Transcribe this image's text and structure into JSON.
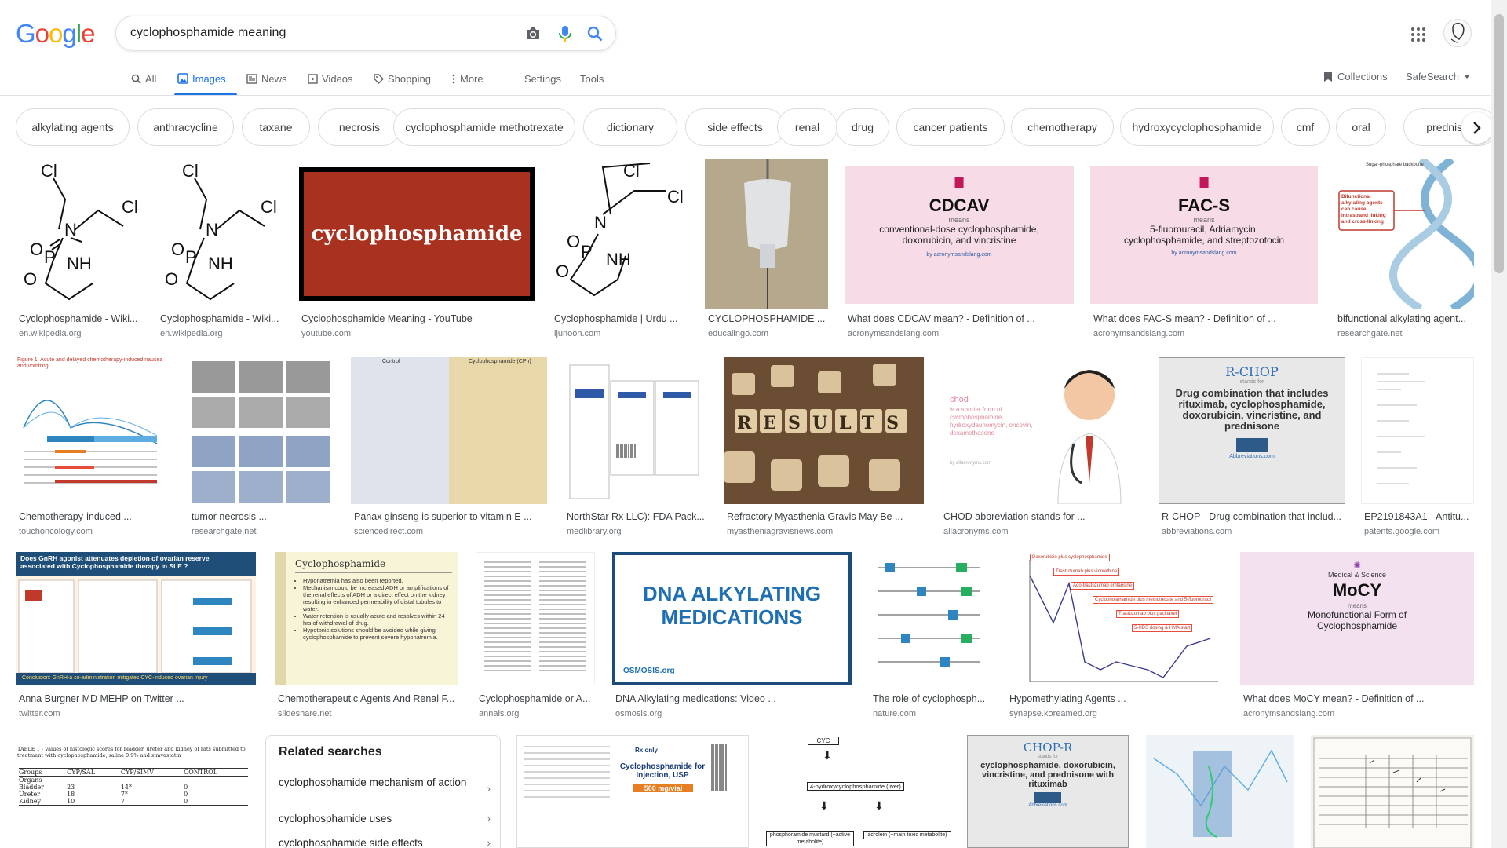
{
  "header": {
    "logo": [
      "G",
      "o",
      "o",
      "g",
      "l",
      "e"
    ],
    "search_value": "cyclophosphamide meaning",
    "icons": [
      "camera-icon",
      "microphone-icon",
      "search-icon",
      "apps-grid-icon"
    ]
  },
  "tabs": [
    {
      "label": "All",
      "icon": "search-icon"
    },
    {
      "label": "Images",
      "icon": "image-icon"
    },
    {
      "label": "News",
      "icon": "newspaper-icon"
    },
    {
      "label": "Videos",
      "icon": "video-icon"
    },
    {
      "label": "Shopping",
      "icon": "tag-icon"
    },
    {
      "label": "More",
      "icon": "more-vert-icon"
    }
  ],
  "tools": {
    "settings": "Settings",
    "tools": "Tools",
    "collections": "Collections",
    "safesearch": "SafeSearch"
  },
  "chips": [
    "alkylating agents",
    "anthracycline",
    "taxane",
    "necrosis",
    "cyclophosphamide methotrexate",
    "dictionary",
    "side effects",
    "renal",
    "drug",
    "cancer patients",
    "chemotherapy",
    "hydroxycyclophosphamide",
    "cmf",
    "oral",
    "prednison"
  ],
  "results": [
    {
      "title": "Cyclophosphamide - Wiki...",
      "source": "en.wikipedia.org"
    },
    {
      "title": "Cyclophosphamide - Wiki...",
      "source": "en.wikipedia.org"
    },
    {
      "title": "Cyclophosphamide Meaning - YouTube",
      "source": "youtube.com",
      "image_text": "cyclophosphamide"
    },
    {
      "title": "Cyclophosphamide | Urdu ...",
      "source": "ijunoon.com"
    },
    {
      "title": "CYCLOPHOSPHAMIDE ...",
      "source": "educalingo.com"
    },
    {
      "title": "What does CDCAV mean? - Definition of ...",
      "source": "acronymsandslang.com",
      "image_head": "CDCAV",
      "image_means": "means",
      "image_body": "conventional-dose cyclophosphamide, doxorubicin, and vincristine",
      "image_foot": "by acronymsandslang.com"
    },
    {
      "title": "What does FAC-S mean? - Definition of ...",
      "source": "acronymsandslang.com",
      "image_head": "FAC-S",
      "image_means": "means",
      "image_body": "5-fluorouracil, Adriamycin, cyclophosphamide, and streptozotocin",
      "image_foot": "by acronymsandslang.com"
    },
    {
      "title": "bifunctional alkylating agent...",
      "source": "researchgate.net",
      "image_head": "Sugar-phosphate backbone",
      "image_body": "Bifunctional alkylating agents can cause intrastrand linking and cross-linking"
    },
    {
      "title": "Chemotherapy-induced ...",
      "source": "touchoncology.com",
      "image_head": "Figure 1: Acute and delayed chemotherapy-induced nausea and vomiting"
    },
    {
      "title": "tumor necrosis ...",
      "source": "researchgate.net"
    },
    {
      "title": "Panax ginseng is superior to vitamin E ...",
      "source": "sciencedirect.com",
      "image_left": "Control",
      "image_right": "Cyclophosphamide (CPh)"
    },
    {
      "title": "NorthStar Rx LLC): FDA Pack...",
      "source": "medlibrary.org"
    },
    {
      "title": "Refractory Myasthenia Gravis May Be ...",
      "source": "myastheniagravisnews.com",
      "image_head": "RESULTS"
    },
    {
      "title": "CHOD abbreviation stands for ...",
      "source": "allacronyms.com",
      "image_head": "chod",
      "image_body": "is a shorter form of cyclophosphamide, hydroxydaunomycin, oncovin, dexamethasone",
      "image_foot": "by allacronyms.com"
    },
    {
      "title": "R-CHOP - Drug combination that includ...",
      "source": "abbreviations.com",
      "image_head": "R-CHOP",
      "image_means": "stands for",
      "image_body": "Drug combination that includes rituximab, cyclophosphamide, doxorubicin, vincristine, and prednisone",
      "image_foot": "Abbreviations.com"
    },
    {
      "title": "EP2191843A1 - Antitu...",
      "source": "patents.google.com"
    },
    {
      "title": "Anna Burgner MD MEHP on Twitter ...",
      "source": "twitter.com",
      "image_head": "Does GnRH agonist attenuates depletion of ovarian reserve associated with Cyclophosphamide therapy in SLE ?",
      "image_foot": "Conclusion: GnRH-a co-administration mitigates CYC-induced ovarian injury"
    },
    {
      "title": "Chemotherapeutic Agents And Renal F...",
      "source": "slideshare.net",
      "image_head": "Cyclophosphamide",
      "image_body": [
        "Hyponatremia has also been reported.",
        "Mechanism could be increased ADH or amplifications of the renal effects of ADH or a direct effect on the kidney resulting in enhanced permeability of distal tubules to water.",
        "Water retention is usually acute and resolves within 24 hrs of withdrawal of drug.",
        "Hypotonic solutions should be avoided while giving cyclophosphamide to prevent severe hyponatremia."
      ]
    },
    {
      "title": "Cyclophosphamide or A...",
      "source": "annals.org"
    },
    {
      "title": "DNA Alkylating medications: Video ...",
      "source": "osmosis.org",
      "image_head": "DNA ALKYLATING MEDICATIONS",
      "image_foot": "OSMOSIS.org"
    },
    {
      "title": "The role of cyclophosph...",
      "source": "nature.com"
    },
    {
      "title": "Hypomethylating Agents ...",
      "source": "synapse.koreamed.org",
      "image_labels": [
        "Doxorubicin plus cyclophosphamide",
        "Trastuzumab plus vinorelbine",
        "Ado-trastuzumab emtansine",
        "Cyclophosphamide plus methotrexate and 5-fluorouracil",
        "Trastuzumab plus paclitaxel",
        "5-HDS dosing & HMA start"
      ]
    },
    {
      "title": "What does MoCY mean? - Definition of ...",
      "source": "acronymsandslang.com",
      "image_top": "Medical & Science",
      "image_head": "MoCY",
      "image_means": "means",
      "image_body": "Monofunctional Form of Cyclophosphamide"
    },
    {
      "image_head": "TABLE 1 - Values of histologic scores for bladder, ureter and kidney of rats submitted to treatment with cyclophosphamide, saline 0.9% and simvastatin",
      "image_cols": [
        "Groups",
        "CYP/SAL",
        "CYP/SIMV",
        "CONTROL"
      ],
      "image_rows": [
        [
          "Organs",
          "",
          "",
          ""
        ],
        [
          "Bladder",
          "23",
          "14*",
          "0"
        ],
        [
          "Ureter",
          "18",
          "7*",
          "0"
        ],
        [
          "Kidney",
          "10",
          "7",
          "0"
        ]
      ]
    },
    {
      "image_head": "Cyclophosphamide for Injection, USP",
      "image_dose": "500 mg/vial",
      "image_rx": "Rx only"
    },
    {
      "image_boxes": [
        "CYC",
        "4-hydroxycyclophosphamide (liver)",
        "phosphoramide mustard (~active metabolite)",
        "acrolein (~main toxic metabolite)"
      ]
    },
    {
      "image_head": "CHOP-R",
      "image_means": "stands for",
      "image_body": "cyclophosphamide, doxorubicin, vincristine, and prednisone with rituximab",
      "image_foot": "Abbreviations.com"
    },
    {},
    {}
  ],
  "related": {
    "title": "Related searches",
    "items": [
      "cyclophosphamide mechanism of action",
      "cyclophosphamide uses",
      "cyclophosphamide side effects"
    ]
  }
}
